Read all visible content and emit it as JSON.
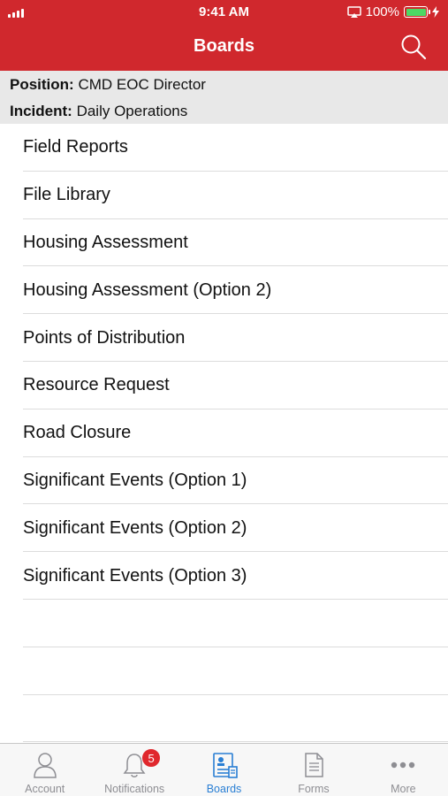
{
  "status_bar": {
    "time": "9:41 AM",
    "battery_percent": "100%",
    "battery_level": 1.0,
    "signal_icon": "signal-bars-icon",
    "airplay_icon": "airplay-icon",
    "charging_icon": "charging-bolt-icon"
  },
  "nav": {
    "title": "Boards",
    "search_icon": "search-icon"
  },
  "info": {
    "position_label": "Position:",
    "position_value": "CMD EOC Director",
    "incident_label": "Incident:",
    "incident_value": "Daily Operations"
  },
  "boards": [
    "Field Reports",
    "File Library",
    "Housing Assessment",
    "Housing Assessment (Option 2)",
    "Points of Distribution",
    "Resource Request",
    "Road Closure",
    "Significant Events (Option 1)",
    "Significant Events (Option 2)",
    "Significant Events (Option 3)"
  ],
  "tabs": [
    {
      "label": "Account",
      "icon": "person-icon",
      "active": false
    },
    {
      "label": "Notifications",
      "icon": "bell-icon",
      "active": false,
      "badge": "5"
    },
    {
      "label": "Boards",
      "icon": "boards-icon",
      "active": true
    },
    {
      "label": "Forms",
      "icon": "form-icon",
      "active": false
    },
    {
      "label": "More",
      "icon": "more-dots-icon",
      "active": false
    }
  ],
  "colors": {
    "brand_red": "#d0282d",
    "active_blue": "#2a7fd4",
    "inactive_gray": "#8e8e93",
    "badge_red": "#e0282d",
    "battery_green": "#4cd964"
  }
}
